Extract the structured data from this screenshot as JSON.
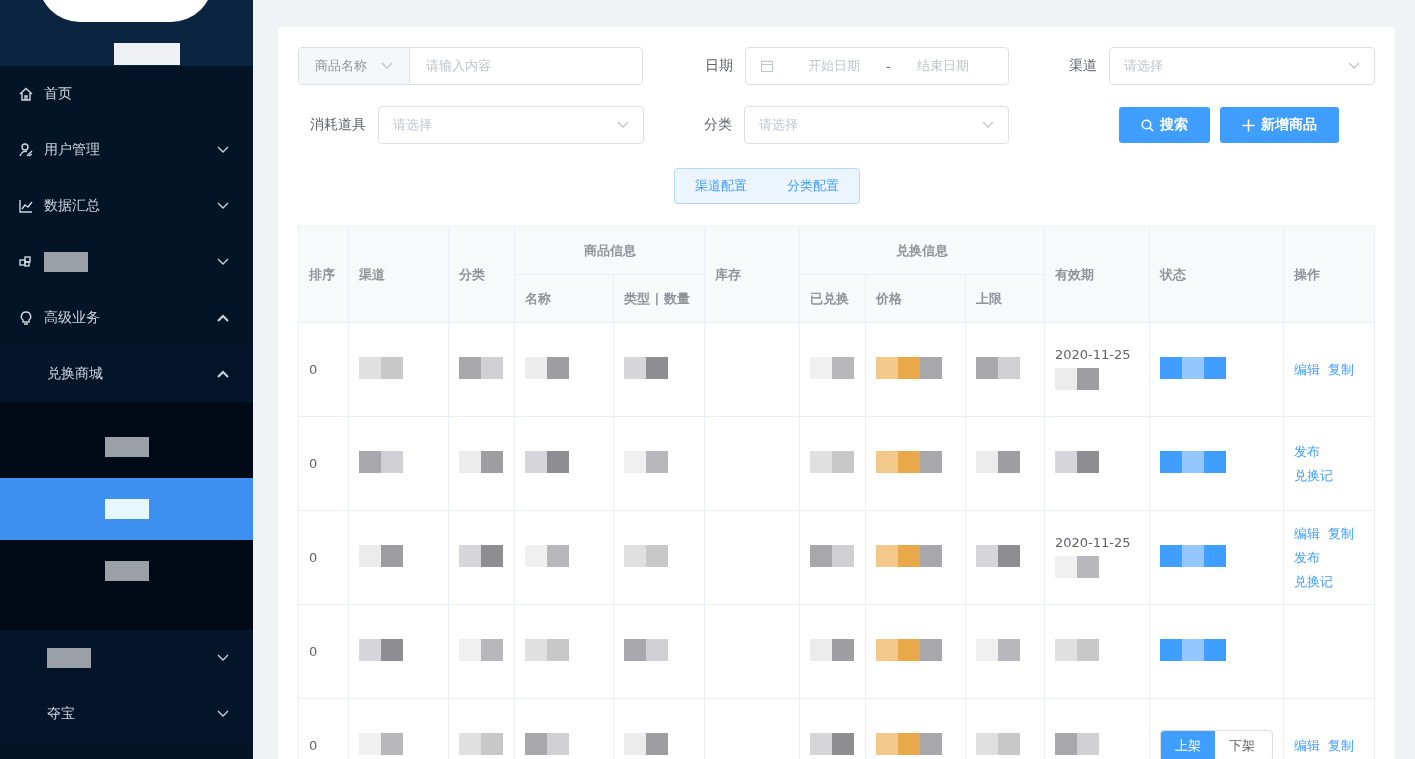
{
  "sidebar": {
    "items": [
      {
        "label": "首页"
      },
      {
        "label": "用户管理",
        "expanded": false
      },
      {
        "label": "数据汇总",
        "expanded": false
      },
      {
        "kind": "redacted",
        "expanded": false
      },
      {
        "label": "高级业务",
        "expanded": true,
        "children": [
          {
            "label": "兑换商城",
            "expanded": true,
            "children": [
              {
                "kind": "redacted",
                "selected": false
              },
              {
                "kind": "redacted",
                "selected": true
              },
              {
                "kind": "redacted",
                "selected": false
              }
            ]
          },
          {
            "kind": "redacted",
            "expanded": false
          },
          {
            "label": "夺宝",
            "expanded": false
          }
        ]
      }
    ]
  },
  "filters": {
    "name_field": {
      "prefix": "商品名称",
      "placeholder": "请输入内容"
    },
    "date": {
      "label": "日期",
      "start_placeholder": "开始日期",
      "separator": "-",
      "end_placeholder": "结束日期"
    },
    "channel": {
      "label": "渠道",
      "placeholder": "请选择"
    },
    "consumable": {
      "label": "消耗道具",
      "placeholder": "请选择"
    },
    "category": {
      "label": "分类",
      "placeholder": "请选择"
    },
    "buttons": [
      {
        "kind": "search",
        "label": "搜索"
      },
      {
        "kind": "add",
        "label": "新增商品"
      }
    ],
    "config_buttons": [
      "渠道配置",
      "分类配置"
    ]
  },
  "table": {
    "groups": [
      {
        "label": "排序"
      },
      {
        "label": "渠道"
      },
      {
        "label": "分类"
      },
      {
        "label": "商品信息",
        "sub": [
          "名称",
          "类型 | 数量"
        ]
      },
      {
        "label": "库存"
      },
      {
        "label": "兑换信息",
        "sub": [
          "已兑换",
          "价格",
          "上限"
        ]
      },
      {
        "label": "有效期"
      },
      {
        "label": "状态"
      },
      {
        "label": "操作"
      }
    ],
    "rows": [
      {
        "order": "0",
        "expiry": "2020-11-25",
        "actions": [
          "编辑",
          "复制"
        ]
      },
      {
        "order": "0",
        "actions": [
          "发布",
          "兑换记"
        ]
      },
      {
        "order": "0",
        "expiry": "2020-11-25",
        "actions": [
          "编辑",
          "复制",
          "发布",
          "兑换记"
        ]
      },
      {
        "order": "0"
      },
      {
        "order": "0",
        "status": [
          {
            "label": "上架",
            "selected": true
          },
          {
            "label": "下架",
            "selected": false
          }
        ],
        "actions": [
          "编辑",
          "复制"
        ]
      }
    ]
  }
}
